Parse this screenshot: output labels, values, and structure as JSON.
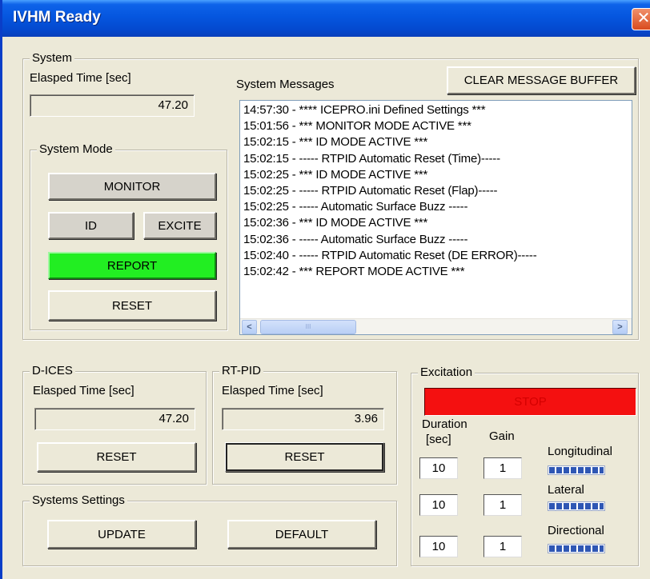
{
  "window": {
    "title": "IVHM Ready",
    "close_glyph": "✕"
  },
  "system": {
    "legend": "System",
    "elapsed_label": "Elasped Time [sec]",
    "elapsed_value": "47.20",
    "messages_label": "System Messages",
    "clear_button": "CLEAR MESSAGE BUFFER",
    "messages": [
      "14:57:30 - **** ICEPRO.ini Defined Settings ***",
      "15:01:56 - *** MONITOR MODE ACTIVE ***",
      "15:02:15 - *** ID MODE ACTIVE ***",
      "15:02:15 - ----- RTPID Automatic Reset (Time)-----",
      "15:02:25 - *** ID MODE ACTIVE ***",
      "15:02:25 - ----- RTPID Automatic Reset (Flap)-----",
      "15:02:25 - ----- Automatic Surface Buzz -----",
      "15:02:36 - *** ID MODE ACTIVE ***",
      "15:02:36 - ----- Automatic Surface Buzz -----",
      "15:02:40 - ----- RTPID Automatic Reset (DE ERROR)-----",
      "15:02:42 - *** REPORT MODE ACTIVE ***"
    ],
    "scroll_left": "<",
    "scroll_right": ">",
    "scroll_grip": "III"
  },
  "system_mode": {
    "legend": "System Mode",
    "monitor": "MONITOR",
    "id": "ID",
    "excite": "EXCITE",
    "report": "REPORT",
    "reset": "RESET",
    "report_color": "#22ee22"
  },
  "dices": {
    "legend": "D-ICES",
    "elapsed_label": "Elasped Time [sec]",
    "elapsed_value": "47.20",
    "reset": "RESET"
  },
  "rtpid": {
    "legend": "RT-PID",
    "elapsed_label": "Elasped Time [sec]",
    "elapsed_value": "3.96",
    "reset": "RESET"
  },
  "settings": {
    "legend": "Systems Settings",
    "update": "UPDATE",
    "default": "DEFAULT"
  },
  "excitation": {
    "legend": "Excitation",
    "stop": "STOP",
    "stop_color": "#f41010",
    "duration_label_1": "Duration",
    "duration_label_2": "[sec]",
    "gain_label": "Gain",
    "channels": [
      {
        "name": "Longitudinal",
        "duration": "10",
        "gain": "1",
        "level": 1.0
      },
      {
        "name": "Lateral",
        "duration": "10",
        "gain": "1",
        "level": 1.0
      },
      {
        "name": "Directional",
        "duration": "10",
        "gain": "1",
        "level": 1.0
      }
    ]
  }
}
